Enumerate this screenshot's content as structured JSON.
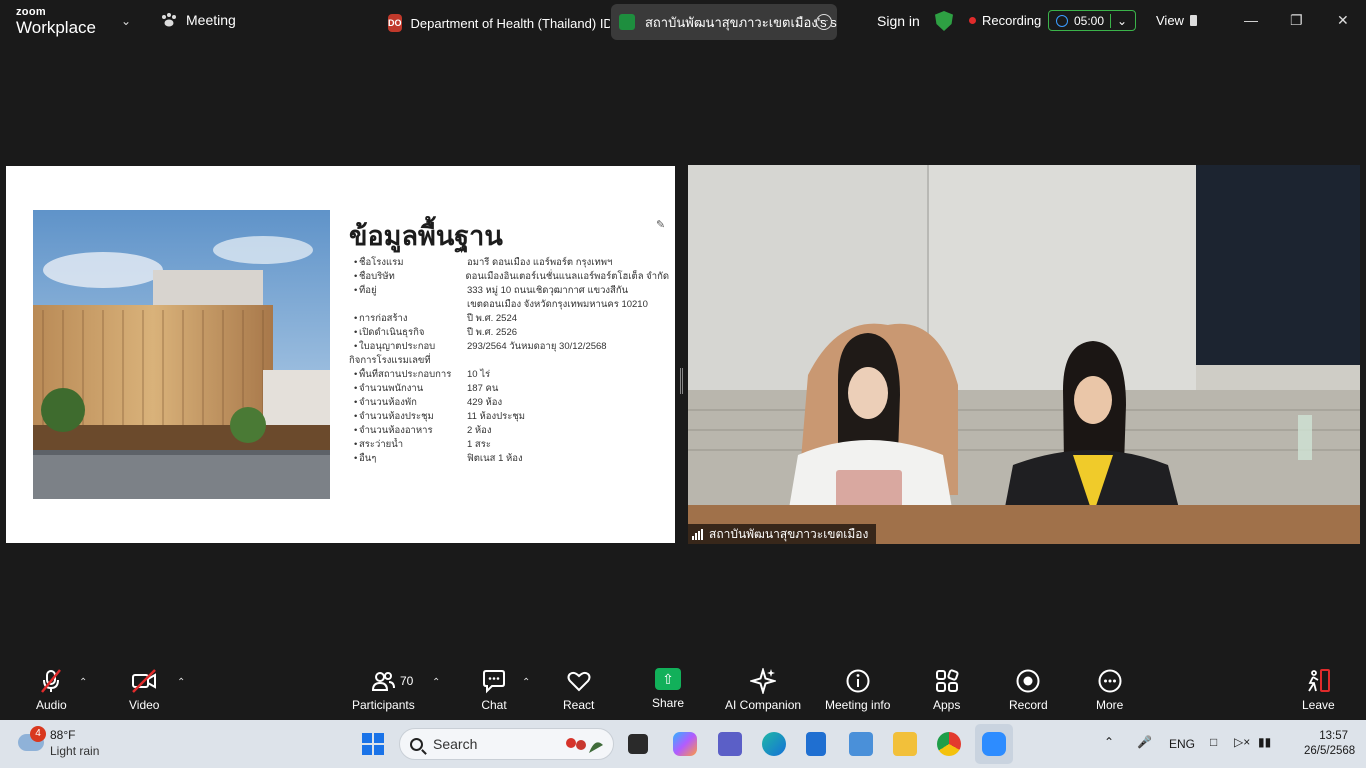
{
  "topbar": {
    "brand_small": "zoom",
    "brand_big": "Workplace",
    "meeting_label": "Meeting",
    "tab1_badge": "DO",
    "tab1_label": "Department of Health (Thailand) IDO",
    "tab2_label": "สถาบันพัฒนาสุขภาวะเขตเมือง's scre",
    "sign_in": "Sign in",
    "recording": "Recording",
    "timer": "05:00",
    "view": "View"
  },
  "slide": {
    "title": "ข้อมูลพื้นฐาน",
    "facts": [
      {
        "label": "ชื่อโรงแรม",
        "value": "อมารี ดอนเมือง แอร์พอร์ต กรุงเทพฯ",
        "bullet": true
      },
      {
        "label": "ชื่อบริษัท",
        "value": "ดอนเมืองอินเตอร์เนชั่นแนลแอร์พอร์ตโฮเต็ล จำกัด",
        "bullet": true
      },
      {
        "label": "ที่อยู่",
        "value": "333 หมู่ 10 ถนนเชิดวุฒากาศ แขวงสีกัน",
        "bullet": true
      },
      {
        "label": "",
        "value": "เขตดอนเมือง จังหวัดกรุงเทพมหานคร 10210",
        "bullet": false
      },
      {
        "label": "การก่อสร้าง",
        "value": "ปี พ.ศ. 2524",
        "bullet": true
      },
      {
        "label": "เปิดดำเนินธุรกิจ",
        "value": "ปี พ.ศ. 2526",
        "bullet": true
      },
      {
        "label": "ใบอนุญาตประกอบ",
        "value": "293/2564   วันหมดอายุ  30/12/2568",
        "bullet": true
      },
      {
        "label": "กิจการโรงแรมเลขที่",
        "value": "",
        "bullet": false,
        "head": true
      },
      {
        "label": "พื้นที่สถานประกอบการ",
        "value": "10 ไร่",
        "bullet": true
      },
      {
        "label": "จำนวนพนักงาน",
        "value": "187 คน",
        "bullet": true
      },
      {
        "label": "จำนวนห้องพัก",
        "value": "429 ห้อง",
        "bullet": true
      },
      {
        "label": "จำนวนห้องประชุม",
        "value": "11 ห้องประชุม",
        "bullet": true
      },
      {
        "label": "จำนวนห้องอาหาร",
        "value": "2 ห้อง",
        "bullet": true
      },
      {
        "label": "สระว่ายน้ำ",
        "value": "1 สระ",
        "bullet": true
      },
      {
        "label": "อื่นๆ",
        "value": "ฟิตเนส 1 ห้อง",
        "bullet": true
      }
    ]
  },
  "video": {
    "participant_name": "สถาบันพัฒนาสุขภาวะเขตเมือง"
  },
  "toolbar": {
    "audio": "Audio",
    "video": "Video",
    "participants": "Participants",
    "participants_count": "70",
    "chat": "Chat",
    "react": "React",
    "share": "Share",
    "ai_companion": "AI Companion",
    "meeting_info": "Meeting info",
    "apps": "Apps",
    "record": "Record",
    "more": "More",
    "leave": "Leave"
  },
  "taskbar": {
    "weather_badge": "4",
    "temp": "88°F",
    "condition": "Light rain",
    "search": "Search",
    "lang": "ENG",
    "time": "13:57",
    "date": "26/5/2568"
  },
  "colors": {
    "accent_green": "#12b05a",
    "record_red": "#e02b2b",
    "leave_red": "#e02b2b"
  }
}
